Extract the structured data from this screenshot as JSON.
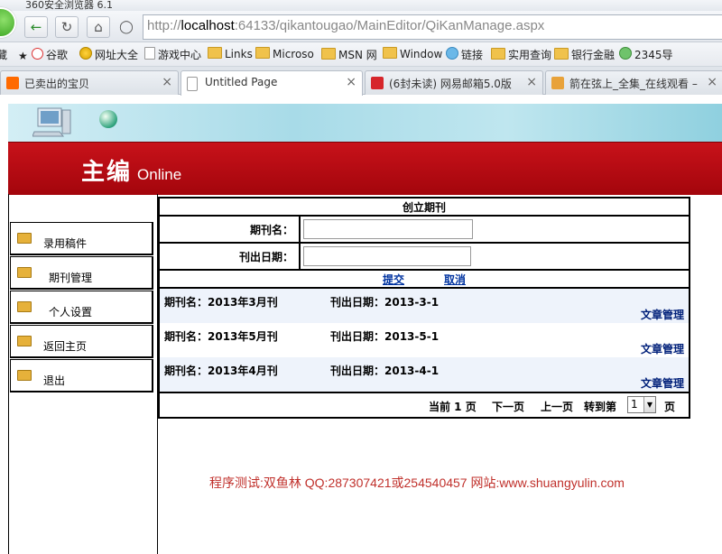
{
  "browser": {
    "title": "360安全浏览器 6.1",
    "url_host": "localhost",
    "url_rest": ":64133/qikantougao/MainEditor/QiKanManage.aspx",
    "bookmarks_label": "藏",
    "bookmarks": [
      "谷歌",
      "网址大全",
      "游戏中心",
      "Links",
      "Microso",
      "MSN 网",
      "Window",
      "链接",
      "实用查询",
      "银行金融",
      "2345导"
    ],
    "tabs": [
      {
        "label": "已卖出的宝贝",
        "icon_color": "#ff6a00"
      },
      {
        "label": "Untitled Page",
        "icon_color": "#ffffff"
      },
      {
        "label": "(6封未读) 网易邮箱5.0版",
        "icon_color": "#d6262b"
      },
      {
        "label": "箭在弦上_全集_在线观看 –",
        "icon_color": "#e8a23a"
      }
    ],
    "close_symbol": "×"
  },
  "brand": {
    "cn": "主编",
    "en": "Online"
  },
  "menu": [
    "录用稿件",
    "期刊管理",
    "个人设置",
    "返回主页",
    "退出"
  ],
  "form": {
    "title": "创立期刊",
    "name_label": "期刊名：",
    "date_label": "刊出日期：",
    "submit": "提交",
    "cancel": "取消"
  },
  "issues": [
    {
      "name": "期刊名：2013年3月刊",
      "date": "刊出日期：2013-3-1",
      "action": "文章管理"
    },
    {
      "name": "期刊名：2013年5月刊",
      "date": "刊出日期：2013-5-1",
      "action": "文章管理"
    },
    {
      "name": "期刊名：2013年4月刊",
      "date": "刊出日期：2013-4-1",
      "action": "文章管理"
    }
  ],
  "pager": {
    "current": "当前 1 页",
    "next": "下一页",
    "prev": "上一页",
    "goto": "转到第",
    "page_value": "1",
    "page_suffix": "页"
  },
  "footer": "程序测试:双鱼林 QQ:287307421或254540457 网站:www.shuangyulin.com"
}
